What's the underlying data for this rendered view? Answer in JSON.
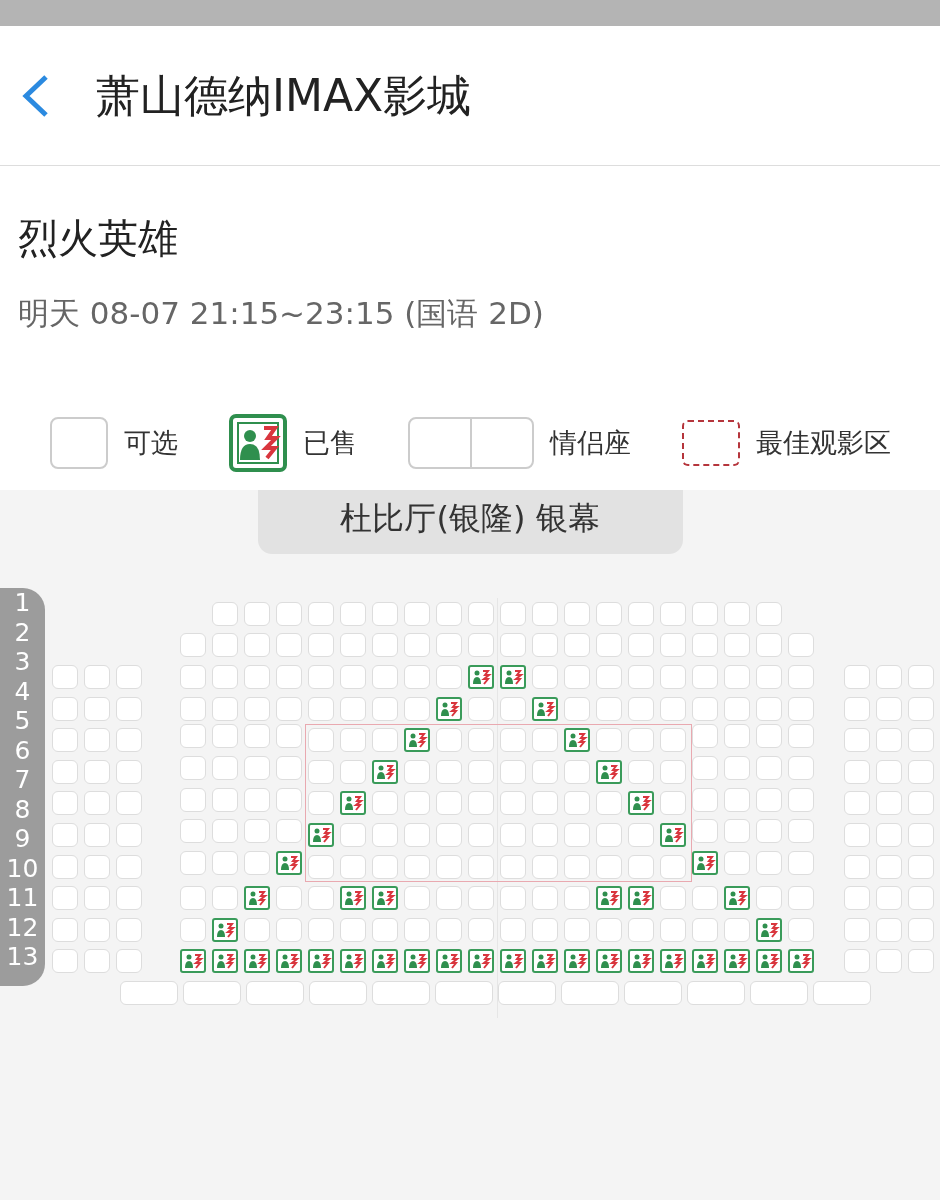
{
  "header": {
    "title": "萧山德纳IMAX影城"
  },
  "movie": {
    "title": "烈火英雄",
    "showtime": "明天 08-07 21:15~23:15 (国语 2D)"
  },
  "legend": [
    {
      "kind": "free",
      "label": "可选"
    },
    {
      "kind": "sold",
      "label": "已售"
    },
    {
      "kind": "couple",
      "label": "情侣座"
    },
    {
      "kind": "best",
      "label": "最佳观影区"
    }
  ],
  "screen": {
    "label": "杜比厅(银隆) 银幕"
  },
  "row_labels": [
    "1",
    "2",
    "3",
    "4",
    "5",
    "6",
    "7",
    "8",
    "9",
    "10",
    "11",
    "12",
    "13"
  ],
  "seat_rows": [
    {
      "kind": "single",
      "center": [
        false,
        false,
        false,
        false,
        false,
        false,
        false,
        false,
        false,
        false,
        false,
        false,
        false,
        false,
        false,
        false,
        false,
        false
      ]
    },
    {
      "kind": "single",
      "center": [
        false,
        false,
        false,
        false,
        false,
        false,
        false,
        false,
        false,
        false,
        false,
        false,
        false,
        false,
        false,
        false,
        false,
        false,
        false,
        false
      ]
    },
    {
      "kind": "single",
      "left": [
        false,
        false,
        false
      ],
      "center": [
        false,
        false,
        false,
        false,
        false,
        false,
        false,
        false,
        false,
        true,
        true,
        false,
        false,
        false,
        false,
        false,
        false,
        false,
        false,
        false
      ],
      "right": [
        false,
        false,
        false
      ]
    },
    {
      "kind": "single",
      "left": [
        false,
        false,
        false
      ],
      "center": [
        false,
        false,
        false,
        false,
        false,
        false,
        false,
        false,
        true,
        false,
        false,
        true,
        false,
        false,
        false,
        false,
        false,
        false,
        false,
        false
      ],
      "right": [
        false,
        false,
        false
      ]
    },
    {
      "kind": "single",
      "left": [
        false,
        false,
        false
      ],
      "center": [
        false,
        false,
        false,
        false
      ],
      "best_zone": [
        false,
        false,
        false,
        true,
        false,
        false,
        false,
        false,
        true,
        false,
        false,
        false
      ],
      "center_after": [
        false,
        false,
        false,
        false
      ],
      "right": [
        false,
        false,
        false
      ]
    },
    {
      "kind": "single",
      "left": [
        false,
        false,
        false
      ],
      "center": [
        false,
        false,
        false,
        false
      ],
      "best_zone": [
        false,
        false,
        true,
        false,
        false,
        false,
        false,
        false,
        false,
        true,
        false,
        false
      ],
      "center_after": [
        false,
        false,
        false,
        false
      ],
      "right": [
        false,
        false,
        false
      ]
    },
    {
      "kind": "single",
      "left": [
        false,
        false,
        false
      ],
      "center": [
        false,
        false,
        false,
        false
      ],
      "best_zone": [
        false,
        true,
        false,
        false,
        false,
        false,
        false,
        false,
        false,
        false,
        true,
        false
      ],
      "center_after": [
        false,
        false,
        false,
        false
      ],
      "right": [
        false,
        false,
        false
      ]
    },
    {
      "kind": "single",
      "left": [
        false,
        false,
        false
      ],
      "center": [
        false,
        false,
        false,
        false
      ],
      "best_zone": [
        true,
        false,
        false,
        false,
        false,
        false,
        false,
        false,
        false,
        false,
        false,
        true
      ],
      "center_after": [
        false,
        false,
        false,
        false
      ],
      "right": [
        false,
        false,
        false
      ]
    },
    {
      "kind": "single",
      "left": [
        false,
        false,
        false
      ],
      "center": [
        false,
        false,
        false,
        true
      ],
      "best_zone": [
        false,
        false,
        false,
        false,
        false,
        false,
        false,
        false,
        false,
        false,
        false,
        false
      ],
      "center_after": [
        true,
        false,
        false,
        false
      ],
      "right": [
        false,
        false,
        false
      ]
    },
    {
      "kind": "single",
      "left": [
        false,
        false,
        false
      ],
      "center": [
        false,
        false,
        true,
        false,
        false,
        true,
        true,
        false,
        false,
        false,
        false,
        false,
        false,
        true,
        true,
        false,
        false,
        true,
        false,
        false
      ],
      "right": [
        false,
        false,
        false
      ]
    },
    {
      "kind": "single",
      "left": [
        false,
        false,
        false
      ],
      "center": [
        false,
        true,
        false,
        false,
        false,
        false,
        false,
        false,
        false,
        false,
        false,
        false,
        false,
        false,
        false,
        false,
        false,
        false,
        true,
        false
      ],
      "right": [
        false,
        false,
        false
      ]
    },
    {
      "kind": "single",
      "left": [
        false,
        false,
        false
      ],
      "center": [
        true,
        true,
        true,
        true,
        true,
        true,
        true,
        true,
        true,
        true,
        true,
        true,
        true,
        true,
        true,
        true,
        true,
        true,
        true,
        true
      ],
      "right": [
        false,
        false,
        false
      ]
    },
    {
      "kind": "couple",
      "seats": [
        false,
        false,
        false,
        false,
        false,
        false,
        false,
        false,
        false,
        false,
        false,
        false
      ]
    }
  ]
}
